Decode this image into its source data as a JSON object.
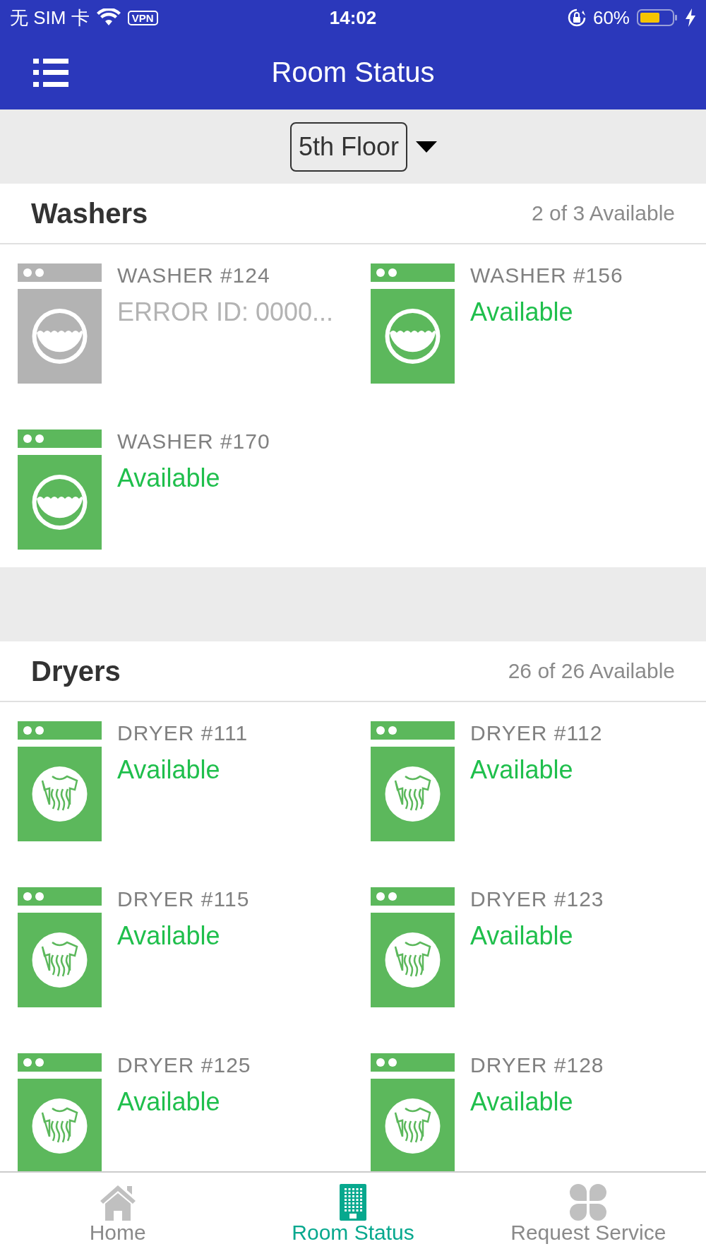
{
  "status_bar": {
    "carrier": "无 SIM 卡",
    "vpn": "VPN",
    "time": "14:02",
    "battery": "60%"
  },
  "header": {
    "title": "Room Status"
  },
  "floor_selector": {
    "value": "5th Floor"
  },
  "sections": [
    {
      "kind": "washer",
      "title": "Washers",
      "count": "2 of 3 Available",
      "machines": [
        {
          "name": "WASHER #124",
          "status": "ERROR ID: 0000...",
          "kind": "error"
        },
        {
          "name": "WASHER #156",
          "status": "Available",
          "kind": "available"
        },
        {
          "name": "WASHER #170",
          "status": "Available",
          "kind": "available"
        }
      ]
    },
    {
      "kind": "dryer",
      "title": "Dryers",
      "count": "26 of 26 Available",
      "machines": [
        {
          "name": "DRYER #111",
          "status": "Available",
          "kind": "available"
        },
        {
          "name": "DRYER #112",
          "status": "Available",
          "kind": "available"
        },
        {
          "name": "DRYER #115",
          "status": "Available",
          "kind": "available"
        },
        {
          "name": "DRYER #123",
          "status": "Available",
          "kind": "available"
        },
        {
          "name": "DRYER #125",
          "status": "Available",
          "kind": "available"
        },
        {
          "name": "DRYER #128",
          "status": "Available",
          "kind": "available"
        }
      ]
    }
  ],
  "tab_bar": [
    {
      "label": "Home",
      "kind": "home",
      "selected": false
    },
    {
      "label": "Room Status",
      "kind": "rooms",
      "selected": true
    },
    {
      "label": "Request Service",
      "kind": "service",
      "selected": false
    }
  ]
}
